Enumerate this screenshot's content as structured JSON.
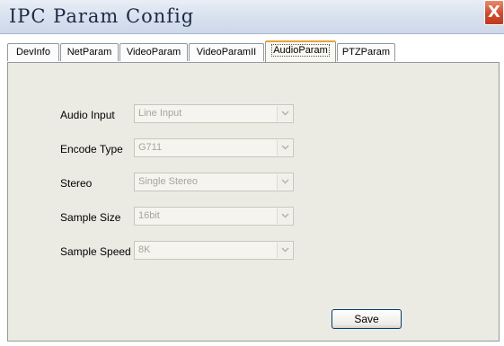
{
  "window": {
    "title": "IPC Param Config",
    "close_glyph": "X"
  },
  "tabs": [
    {
      "label": "DevInfo",
      "active": false
    },
    {
      "label": "NetParam",
      "active": false
    },
    {
      "label": "VideoParam",
      "active": false
    },
    {
      "label": "VideoParamII",
      "active": false
    },
    {
      "label": "AudioParam",
      "active": true
    },
    {
      "label": "PTZParam",
      "active": false
    }
  ],
  "audio": {
    "fields": [
      {
        "label": "Audio Input",
        "value": "Line Input"
      },
      {
        "label": "Encode Type",
        "value": "G711"
      },
      {
        "label": "Stereo",
        "value": "Single Stereo"
      },
      {
        "label": "Sample Size",
        "value": "16bit"
      },
      {
        "label": "Sample Speed",
        "value": "8K"
      }
    ],
    "save_label": "Save"
  },
  "colors": {
    "active_tab_accent": "#e8a33c",
    "close_button": "#d2492a",
    "panel_background": "#ecebe3"
  }
}
